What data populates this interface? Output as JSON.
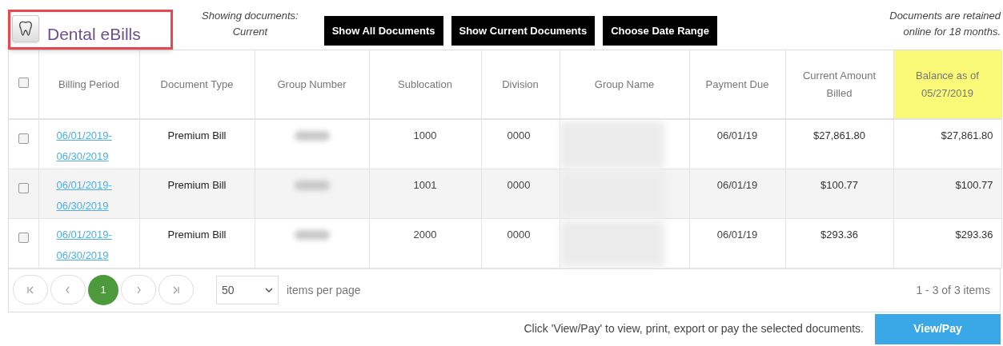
{
  "header": {
    "title": "Dental eBills",
    "showing_label": "Showing documents:",
    "showing_value": "Current",
    "buttons": [
      "Show All Documents",
      "Show Current Documents",
      "Choose Date Range"
    ],
    "retention_note": "Documents are retained online for 18 months."
  },
  "table": {
    "select_all_checked": false,
    "columns": [
      {
        "label": "Billing Period",
        "highlighted": false
      },
      {
        "label": "Document Type",
        "highlighted": false
      },
      {
        "label": "Group Number",
        "highlighted": false
      },
      {
        "label": "Sublocation",
        "highlighted": false
      },
      {
        "label": "Division",
        "highlighted": false
      },
      {
        "label": "Group Name",
        "highlighted": false
      },
      {
        "label": "Payment Due",
        "highlighted": false
      },
      {
        "label": "Current Amount Billed",
        "highlighted": false
      },
      {
        "label": "Balance as of 05/27/2019",
        "highlighted": true
      }
    ],
    "rows": [
      {
        "checked": false,
        "billing_period": "06/01/2019-06/30/2019",
        "document_type": "Premium Bill",
        "sublocation": "1000",
        "division": "0000",
        "payment_due": "06/01/19",
        "current_amount_billed": "$27,861.80",
        "balance": "$27,861.80"
      },
      {
        "checked": false,
        "billing_period": "06/01/2019-06/30/2019",
        "document_type": "Premium Bill",
        "sublocation": "1001",
        "division": "0000",
        "payment_due": "06/01/19",
        "current_amount_billed": "$100.77",
        "balance": "$100.77"
      },
      {
        "checked": false,
        "billing_period": "06/01/2019-06/30/2019",
        "document_type": "Premium Bill",
        "sublocation": "2000",
        "division": "0000",
        "payment_due": "06/01/19",
        "current_amount_billed": "$293.36",
        "balance": "$293.36"
      }
    ]
  },
  "pager": {
    "pages": [
      {
        "label": "1",
        "selected": true
      }
    ],
    "page_size": "50",
    "page_size_label": "items per page",
    "summary": "1 - 3 of 3 items"
  },
  "footer": {
    "hint": "Click 'View/Pay' to view, print, export or pay the selected documents.",
    "button": "View/Pay"
  }
}
